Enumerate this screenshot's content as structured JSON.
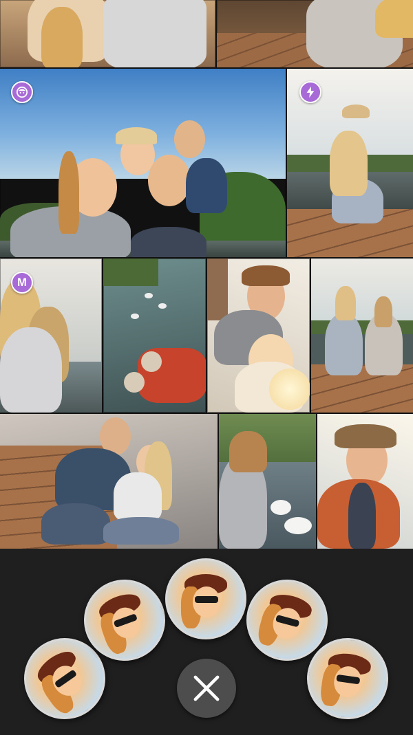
{
  "collage": {
    "badges": {
      "face_badge_icon": "face-icon",
      "flash_badge_icon": "lightning-icon",
      "m_badge_label": "M"
    },
    "accent_color": "#a86ad6"
  },
  "tray": {
    "close_icon": "close-icon",
    "sticker_count": 5
  }
}
